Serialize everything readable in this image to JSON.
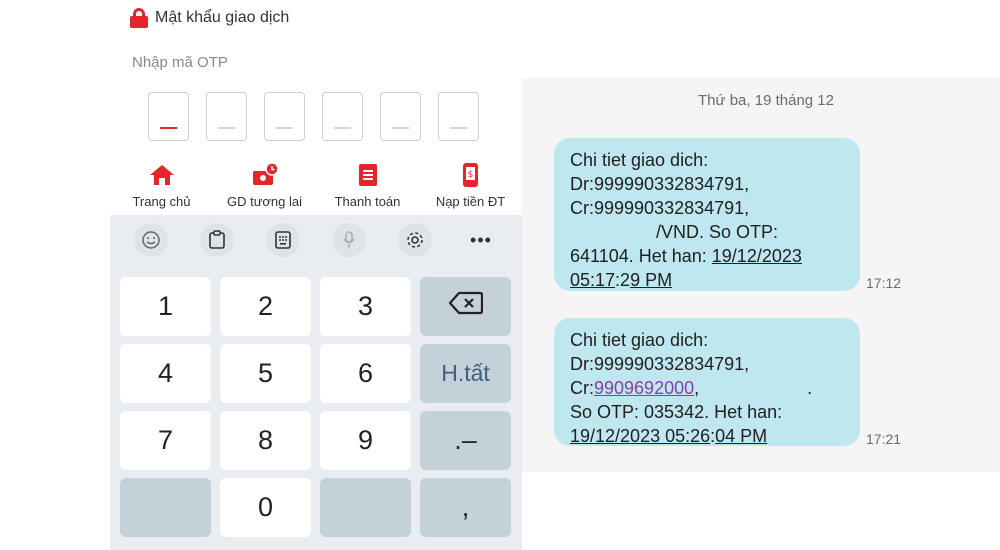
{
  "header": {
    "title": "Mật khẩu giao dịch",
    "otp_label": "Nhập mã OTP"
  },
  "otp_boxes": [
    "_",
    "_",
    "_",
    "_",
    "_",
    "_"
  ],
  "bottom_nav": [
    {
      "label": "Trang chủ",
      "icon": "home-icon"
    },
    {
      "label": "GD tương lai",
      "icon": "future-transaction-icon"
    },
    {
      "label": "Thanh toán",
      "icon": "bill-icon"
    },
    {
      "label": "Nạp tiền ĐT",
      "icon": "phone-topup-icon"
    }
  ],
  "keyboard": {
    "toolbar": [
      "emoji-icon",
      "clipboard-icon",
      "keyboard-icon",
      "mic-icon",
      "settings-icon",
      "more-icon"
    ],
    "more_label": "•••",
    "keys": {
      "k1": "1",
      "k2": "2",
      "k3": "3",
      "k4": "4",
      "k5": "5",
      "k6": "6",
      "k7": "7",
      "k8": "8",
      "k9": "9",
      "k0": "0",
      "done": "H.tất",
      "dot_minus": ".–",
      "comma": ","
    }
  },
  "sms": {
    "date": "Thứ ba, 19 tháng 12",
    "messages": [
      {
        "line1": "Chi tiet giao dich:",
        "line2": "Dr:999990332834791,",
        "line3": "Cr:999990332834791,",
        "line4": "/VND. So OTP:",
        "line5a": "641104. Het han: ",
        "line5b": "19/12/2023",
        "line6a": "05:17",
        "line6b": ":2",
        "line6c": "9 PM",
        "time": "17:12"
      },
      {
        "line1": "Chi tiet giao dich:",
        "line2": "Dr:999990332834791,",
        "line3a": "Cr:",
        "line3b": "9909692000",
        "line3c": ",",
        "line3d": ".",
        "line4": "So OTP: 035342. Het han:",
        "line5a": "19/12/2023 05:26",
        "line5b": ":",
        "line5c": "04 PM",
        "time": "17:21"
      }
    ]
  },
  "colors": {
    "accent_red": "#e4262c",
    "bubble_bg": "#bfe7f0",
    "link_purple": "#8a3ea6",
    "keyboard_bg": "#e9edf1",
    "key_dark": "#c5d1d9"
  }
}
